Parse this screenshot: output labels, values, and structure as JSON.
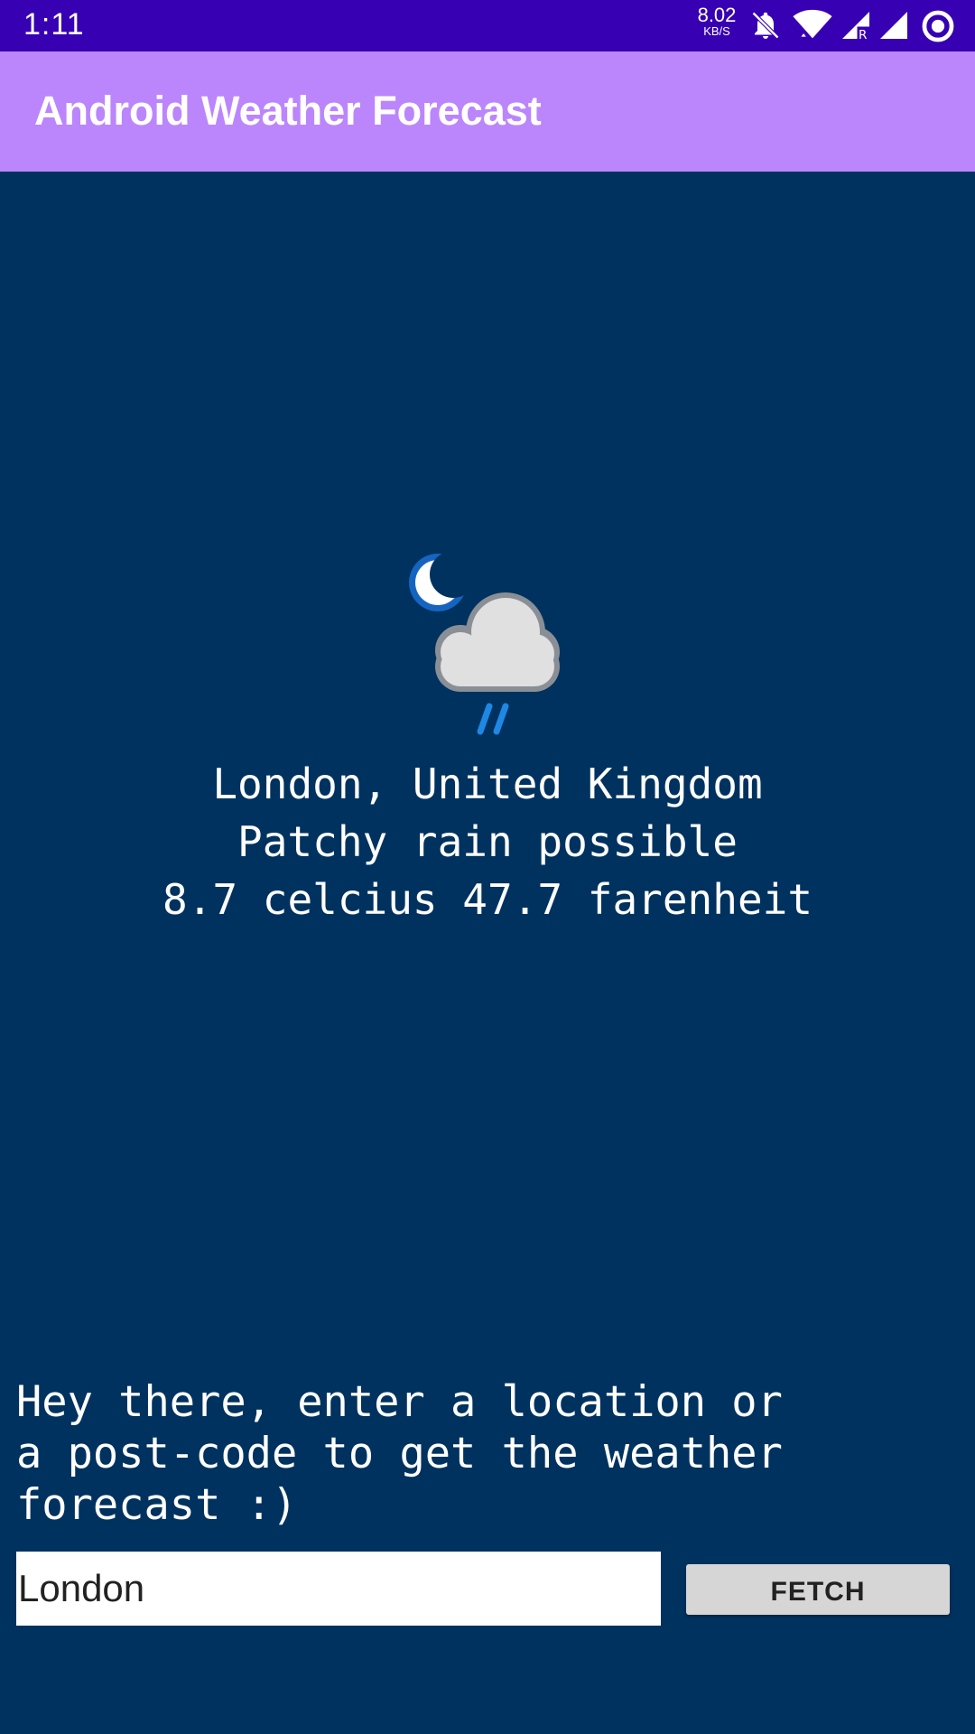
{
  "status_bar": {
    "time": "1:11",
    "network_speed": "8.02",
    "network_speed_unit": "KB/S",
    "icons": [
      "bell-off-icon",
      "wifi-icon",
      "signal-r-icon",
      "signal-icon",
      "sync-circle-icon"
    ]
  },
  "app_bar": {
    "title": "Android Weather Forecast",
    "color": "#bb86fc"
  },
  "weather": {
    "icon": "night-cloud-rain-icon",
    "location": "London, United Kingdom",
    "condition": "Patchy rain possible",
    "temperature": "8.7 celcius 47.7 farenheit"
  },
  "prompt": {
    "lines": [
      "Hey there, enter a location or",
      "a post-code to get the weather",
      "forecast :)"
    ]
  },
  "search": {
    "value": "London"
  },
  "fetch_button": {
    "label": "FETCH"
  },
  "colors": {
    "background": "#00325f",
    "status_bar": "#3700b3"
  }
}
